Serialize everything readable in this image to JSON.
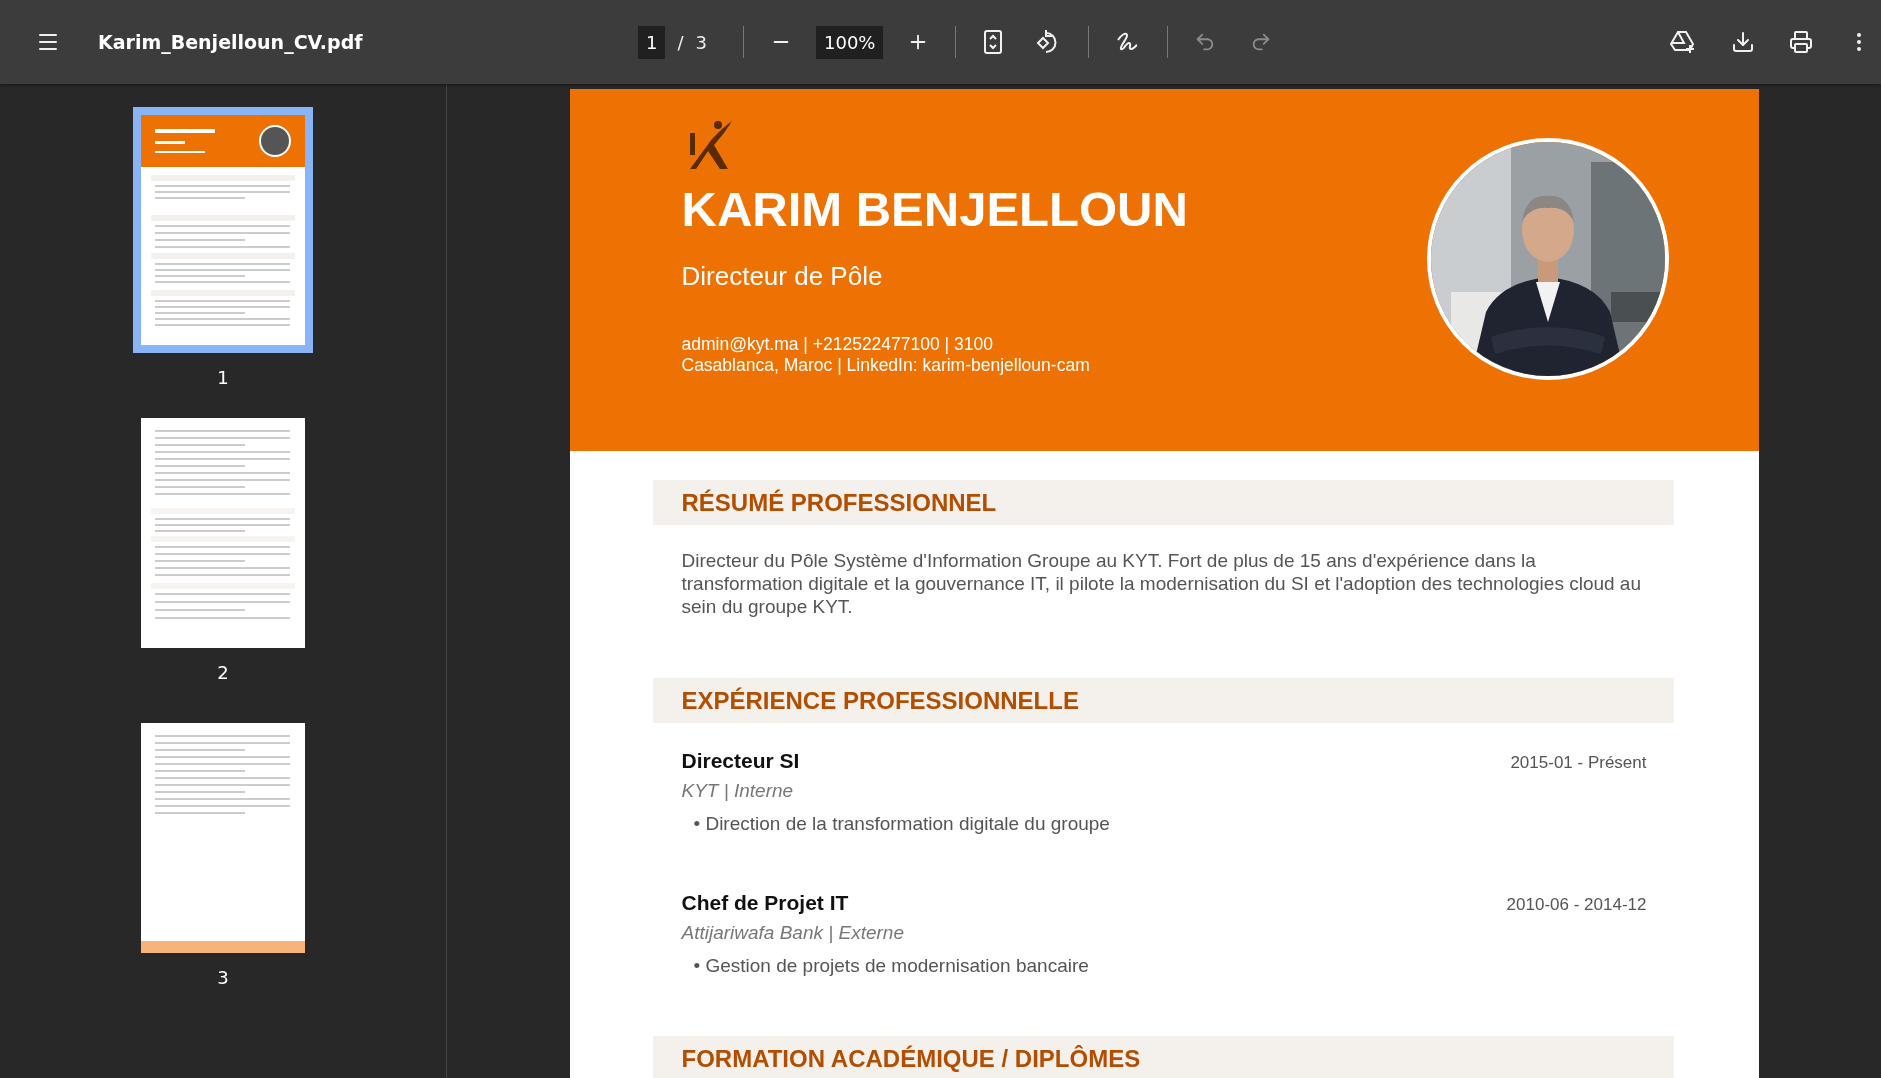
{
  "toolbar": {
    "file_name": "Karim_Benjelloun_CV.pdf",
    "page_number": "1",
    "page_separator": "/",
    "page_count": "3",
    "zoom": "100%",
    "undo": {
      "disabled": true
    },
    "redo": {
      "disabled": true
    }
  },
  "thumbnails": [
    {
      "label": "1",
      "selected": true,
      "kind": "cover"
    },
    {
      "label": "2",
      "selected": false,
      "kind": "content"
    },
    {
      "label": "3",
      "selected": false,
      "kind": "closing"
    }
  ],
  "document": {
    "header": {
      "name": "KARIM BENJELLOUN",
      "title": "Directeur de Pôle",
      "contact_lines": [
        "admin@kyt.ma | +212522477100 | 3100",
        "Casablanca, Maroc | LinkedIn: karim-benjelloun-cam"
      ],
      "photo": {
        "kind": "picture"
      }
    },
    "sections": [
      {
        "heading": "RÉSUMÉ PROFESSIONNEL",
        "kind": "summary",
        "text": "Directeur du Pôle Système d'Information Groupe au KYT. Fort de plus de 15 ans d'expérience dans la transformation digitale et la gouvernance IT, il pilote la modernisation du SI et l'adoption des technologies cloud au sein du groupe KYT."
      },
      {
        "heading": "EXPÉRIENCE PROFESSIONNELLE",
        "kind": "jobs",
        "jobs": [
          {
            "role": "Directeur SI",
            "dates": "2015-01 - Présent",
            "company": "KYT | Interne",
            "bullets": [
              "• Direction de la transformation digitale du groupe"
            ]
          },
          {
            "role": "Chef de Projet IT",
            "dates": "2010-06 - 2014-12",
            "company": "Attijariwafa Bank | Externe",
            "bullets": [
              "• Gestion de projets de modernisation bancaire"
            ]
          }
        ]
      },
      {
        "heading": "FORMATION ACADÉMIQUE / DIPLÔMES",
        "kind": "heading_only"
      }
    ]
  }
}
